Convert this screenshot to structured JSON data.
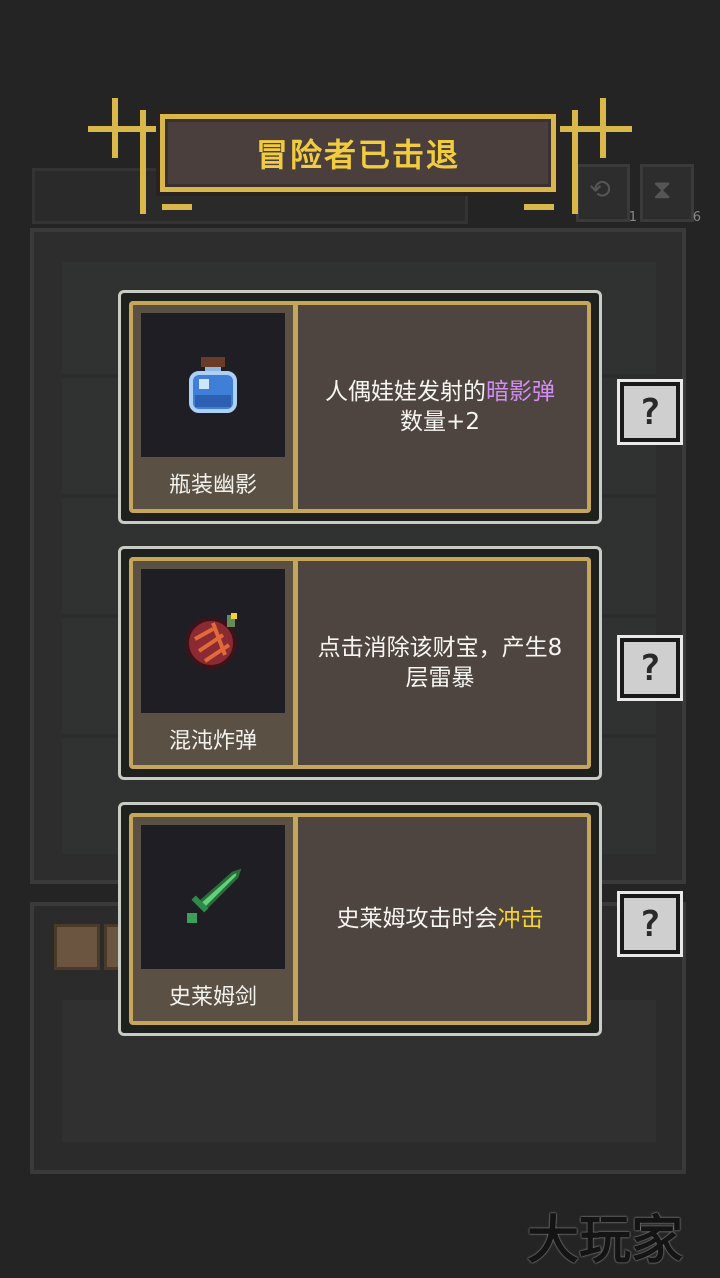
{
  "banner": {
    "title": "冒险者已击退"
  },
  "counters": [
    {
      "value": "1"
    },
    {
      "value": "6"
    }
  ],
  "cards": [
    {
      "name": "瓶装幽影",
      "icon": "bottled-shadow-icon",
      "desc_before": "人偶娃娃发射的",
      "desc_highlight": "暗影弹",
      "desc_after": "数量+2",
      "highlight_color": "#d38df5"
    },
    {
      "name": "混沌炸弹",
      "icon": "chaos-bomb-icon",
      "desc_before": "点击消除该财宝，产生8层雷暴",
      "desc_highlight": "",
      "desc_after": ""
    },
    {
      "name": "史莱姆剑",
      "icon": "slime-sword-icon",
      "desc_before": "史莱姆攻击时会",
      "desc_highlight": "冲击",
      "desc_after": "",
      "highlight_color": "#f3d42b"
    }
  ],
  "help_button": {
    "label": "?"
  },
  "watermark": "大玩家"
}
